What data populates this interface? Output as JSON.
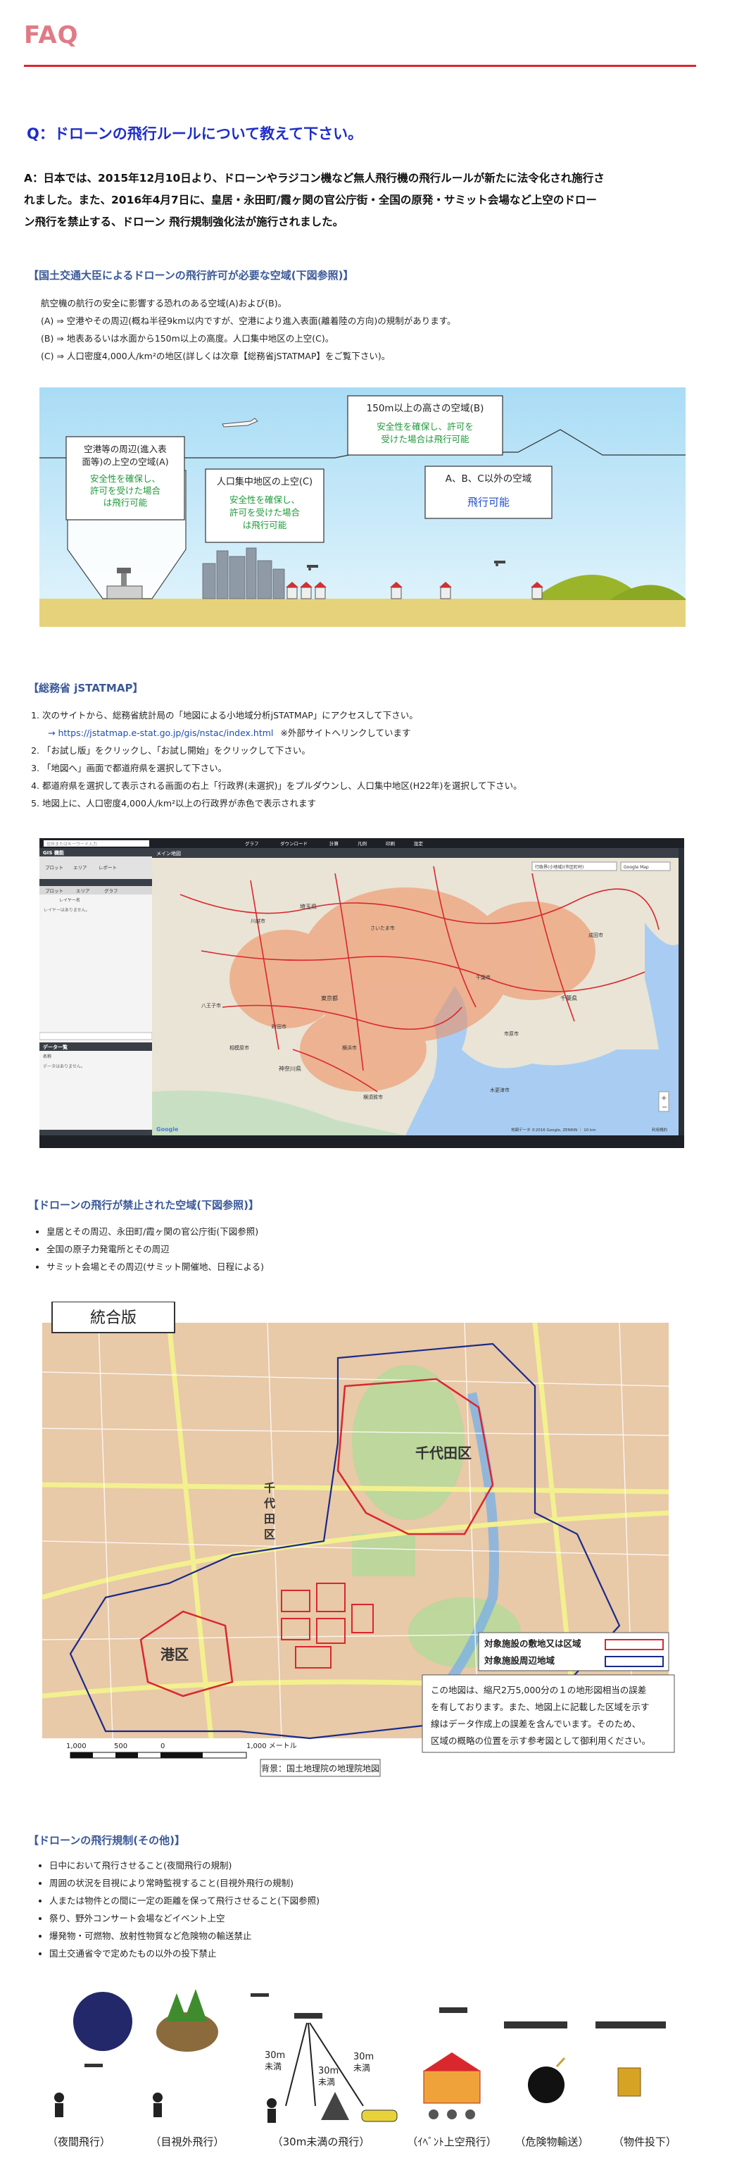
{
  "page_title": "FAQ",
  "question": "Q：ドローンの飛行ルールについて教えて下さい。",
  "answer": {
    "lines": [
      "A：日本では、2015年12月10日より、ドローンやラジコン機など無人飛行機の飛行ルールが新たに法令化され施行さ",
      "れました。また、2016年4月7日に、皇居・永田町/霞ヶ関の官公庁街・全国の原発・サミット会場など上空のドロー",
      "ン飛行を禁止する、ドローン 飛行規制強化法が施行されました。"
    ]
  },
  "section1": {
    "heading": "【国土交通大臣によるドローンの飛行許可が必要な空域(下図参照)】",
    "lines": [
      "航空機の航行の安全に影響する恐れのある空域(A)および(B)。",
      "(A) ⇒ 空港やその周辺(概ね半径9km以内ですが、空港により進入表面(離着陸の方向)の規制があります。",
      "(B) ⇒ 地表あるいは水面から150m以上の高度。人口集中地区の上空(C)。",
      "(C) ⇒ 人口密度4,000人/km²の地区(詳しくは次章【総務省jSTATMAP】をご覧下さい)。"
    ],
    "diagram": {
      "box_b_title": "150m以上の高さの空域(B)",
      "box_b_text": [
        "安全性を確保し、許可を",
        "受けた場合は飛行可能"
      ],
      "box_a_title": [
        "空港等の周辺(進入表",
        "面等)の上空の空域(A)"
      ],
      "box_a_text": [
        "安全性を確保し、",
        "許可を受けた場合",
        "は飛行可能"
      ],
      "box_c_title": "人口集中地区の上空(C)",
      "box_c_text": [
        "安全性を確保し、",
        "許可を受けた場合",
        "は飛行可能"
      ],
      "box_d_title": "A、B、C以外の空域",
      "box_d_text": "飛行可能"
    }
  },
  "section2": {
    "heading": "【総務省 jSTATMAP】",
    "steps": [
      "次のサイトから、総務省統計局の「地図による小地域分析jSTATMAP」にアクセスして下さい。",
      "「お試し版」をクリックし、「お試し開始」をクリックして下さい。",
      "「地図へ」画面で都道府県を選択して下さい。",
      "都道府県を選択して表示される画面の右上「行政界(未選択)」をプルダウンし、人口集中地区(H22年)を選択して下さい。",
      "地図上に、人口密度4,000人/km²以上の行政界が赤色で表示されます"
    ],
    "link_text": "→ https://jstatmap.e-stat.go.jp/gis/nstac/index.html",
    "link_note": "※外部サイトへリンクしています",
    "screenshot": {
      "search_placeholder": "住所またはキーワード入力",
      "toolbar_items": [
        "グラフ",
        "ダウンロード",
        "計算",
        "凡例",
        "印刷",
        "設定"
      ],
      "panel_title": "GIS 機能",
      "panel_tabs": [
        "プロット",
        "エリア",
        "レポート"
      ],
      "layer_tabs": [
        "プロット",
        "エリア",
        "グラフ"
      ],
      "layer_label": "レイヤー名",
      "layer_empty": "レイヤーはありません。",
      "data_title": "データ一覧",
      "data_col": "名称",
      "data_empty": "データはありません。",
      "map_tab": "メイン地図",
      "dropdown1": "行政界(小地域)(市区町村)",
      "dropdown2": "Google Map",
      "map_labels": [
        "埼玉県",
        "東京都",
        "千葉県",
        "神奈川県",
        "横浜市",
        "千葉市",
        "さいたま市",
        "川越市",
        "相模原市",
        "木更津市",
        "市原市",
        "成田市",
        "八王子市",
        "町田市",
        "横須賀市"
      ],
      "copyright": "地図データ ©2016 Google, ZENRIN ｜ 10 km",
      "terms": "利用規約",
      "map_logo": "Google"
    }
  },
  "section3": {
    "heading": "【ドローンの飛行が禁止された空域(下図参照)】",
    "bullets": [
      "皇居とその周辺、永田町/霞ヶ関の官公庁街(下図参照)",
      "全国の原子力発電所とその周辺",
      "サミット会場とその周辺(サミット開催地、日程による)"
    ],
    "map": {
      "label": "統合版",
      "ward1": "千代田区",
      "ward2": "港区",
      "ward3": [
        "千",
        "代",
        "田",
        "区"
      ],
      "legend1": "対象施設の敷地又は区域",
      "legend2": "対象施設周辺地域",
      "note": [
        "この地図は、縮尺2万5,000分の１の地形図相当の誤差",
        "を有しております。また、地図上に記載した区域を示す",
        "線はデータ作成上の誤差を含んでいます。そのため、",
        "区域の概略の位置を示す参考図として御利用ください。"
      ],
      "scale_labels": [
        "1,000",
        "500",
        "0",
        "1,000 メートル"
      ],
      "source": "背景：国土地理院の地理院地図",
      "colors": {
        "site": "#d9272e",
        "surrounding": "#1a2a8a"
      }
    }
  },
  "section4": {
    "heading": "【ドローンの飛行規制(その他)】",
    "bullets": [
      "日中において飛行させること(夜間飛行の規制)",
      "周囲の状況を目視により常時監視すること(目視外飛行の規制)",
      "人または物件との間に一定の距離を保って飛行させること(下図参照)",
      "祭り、野外コンサート会場などイベント上空",
      "爆発物・可燃物、放射性物質など危険物の輸送禁止",
      "国土交通省令で定めたもの以外の投下禁止"
    ],
    "illustration": {
      "distance_labels": [
        "30m",
        "未満",
        "30m",
        "未満",
        "30m",
        "未満"
      ],
      "captions": [
        "（夜間飛行）",
        "（目視外飛行）",
        "（30m未満の飛行）",
        "（ｲﾍﾞﾝﾄ上空飛行）",
        "（危険物輸送）",
        "（物件投下）"
      ]
    }
  }
}
